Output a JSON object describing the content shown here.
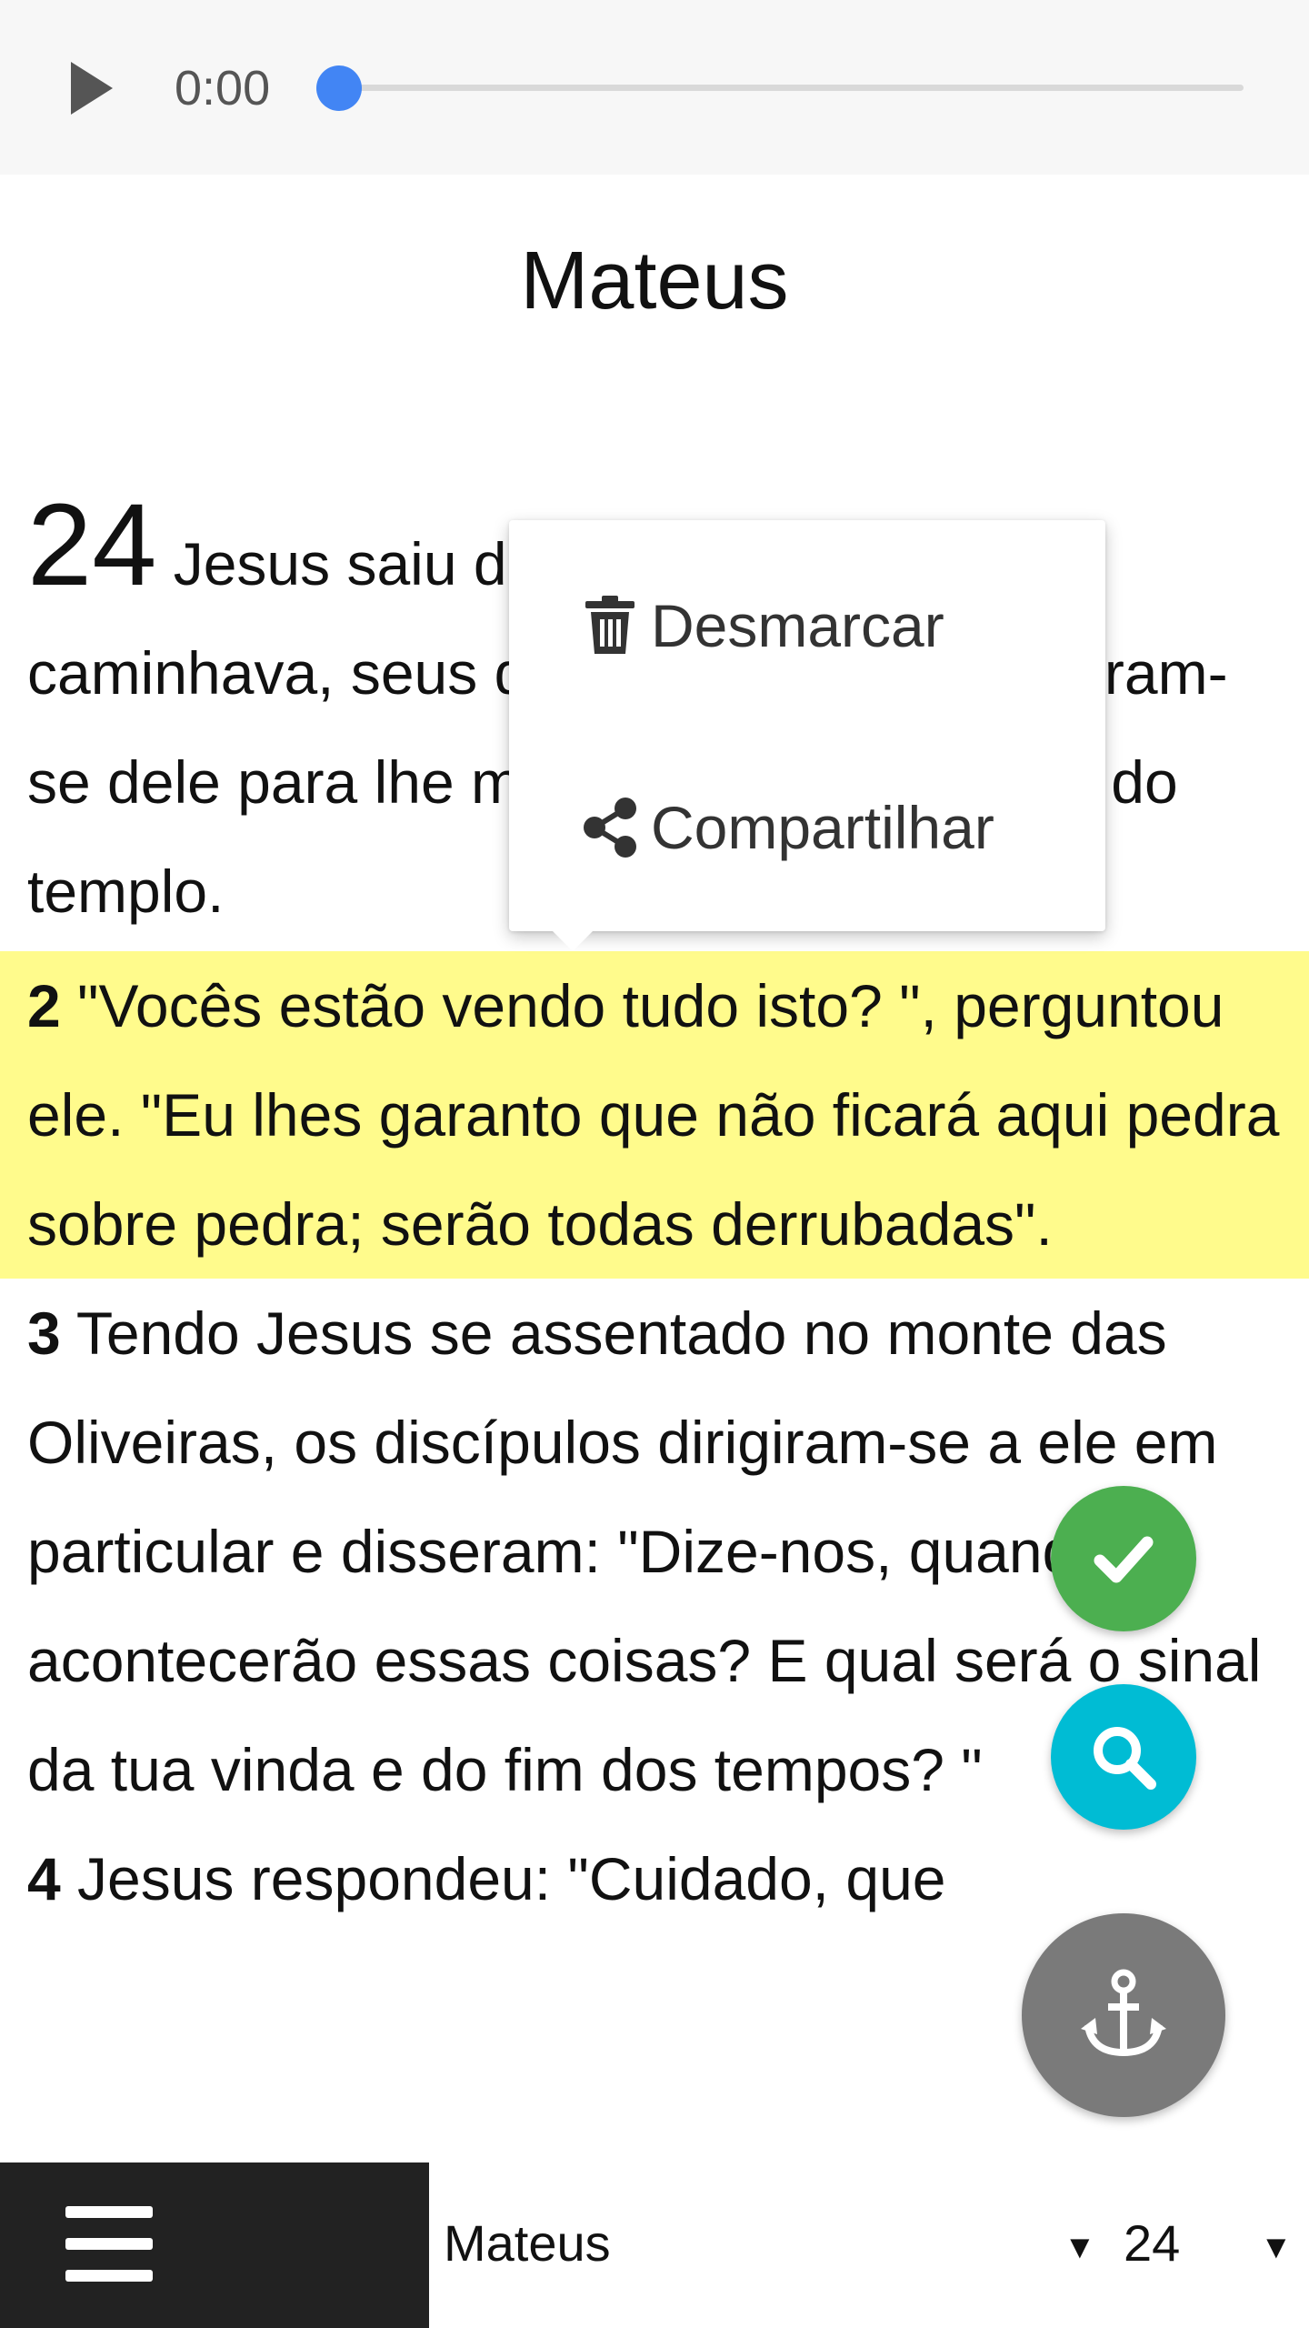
{
  "audio_player": {
    "time": "0:00",
    "progress": 0,
    "play_icon": "play-icon"
  },
  "book_title": "Mateus",
  "chapter": {
    "number": "24",
    "verse_1_text": " Jesus saiu do templo e, enquanto caminhava, seus discípulos se aproximaram-se dele para lhe mostrar as construções do templo.",
    "verse_2_num": "2",
    "verse_2_text": " \"Vocês estão vendo tudo isto? \", perguntou ele. \"Eu lhes garanto que não ficará aqui pedra sobre pedra; serão todas derrubadas\".",
    "verse_3_num": "3",
    "verse_3_text": " Tendo Jesus se assentado no monte das Oliveiras, os discípulos dirigiram-se a ele em particular e disseram: \"Dize-nos, quando acontecerão essas coisas? E qual será o sinal da tua vinda e do fim dos tempos? \"",
    "verse_4_num": "4",
    "verse_4_text": " Jesus respondeu: \"Cuidado, que"
  },
  "context_menu": {
    "unmark_label": "Desmarcar",
    "unmark_icon": "trash-icon",
    "share_label": "Compartilhar",
    "share_icon": "share-icon"
  },
  "fabs": {
    "check_icon": "check-icon",
    "search_icon": "search-icon",
    "anchor_icon": "anchor-icon"
  },
  "bottom_bar": {
    "menu_icon": "hamburger-menu-icon",
    "book_value": "Mateus",
    "chapter_value": "24",
    "dropdown_arrow": "▼"
  },
  "colors": {
    "highlight": "#fffb8c",
    "accent_blue": "#4285f4",
    "fab_green": "#4caf50",
    "fab_cyan": "#00bcd4",
    "fab_grey": "#7a7a7a",
    "bottom_dark": "#222222"
  }
}
